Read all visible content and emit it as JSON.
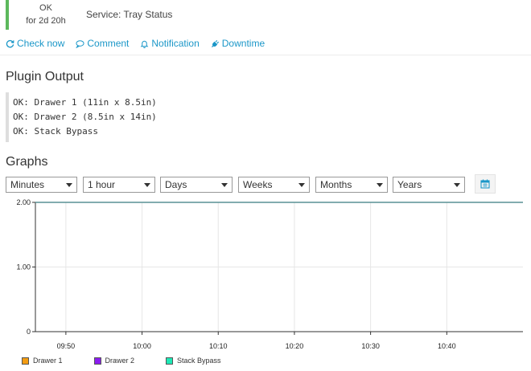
{
  "status": {
    "state": "OK",
    "duration": "for 2d 20h",
    "service": "Service: Tray Status",
    "color": "#5cb85c"
  },
  "actions": [
    {
      "label": "Check now",
      "icon": "refresh-icon"
    },
    {
      "label": "Comment",
      "icon": "comment-icon"
    },
    {
      "label": "Notification",
      "icon": "bell-icon"
    },
    {
      "label": "Downtime",
      "icon": "plug-icon"
    }
  ],
  "plugin_output": {
    "title": "Plugin Output",
    "lines": [
      "OK: Drawer 1 (11in x 8.5in)",
      "OK: Drawer 2 (8.5in x 14in)",
      "OK: Stack Bypass"
    ]
  },
  "graphs": {
    "title": "Graphs",
    "selects": [
      {
        "value": "Minutes"
      },
      {
        "value": "1 hour"
      },
      {
        "value": "Days"
      },
      {
        "value": "Weeks"
      },
      {
        "value": "Months"
      },
      {
        "value": "Years"
      }
    ],
    "calendar_icon": "calendar-icon"
  },
  "chart_data": {
    "type": "line",
    "x": [
      "09:50",
      "10:00",
      "10:10",
      "10:20",
      "10:30",
      "10:40"
    ],
    "y_ticks": [
      "2.00",
      "1.00",
      "0"
    ],
    "ylim": [
      0,
      2
    ],
    "x_start_minutes": 586,
    "x_end_minutes": 650,
    "grid": true,
    "series": [
      {
        "name": "Drawer 1",
        "color": "#f39c12",
        "values": [
          2,
          2,
          2,
          2,
          2,
          2
        ]
      },
      {
        "name": "Drawer 2",
        "color": "#8b1cf0",
        "values": [
          2,
          2,
          2,
          2,
          2,
          2
        ]
      },
      {
        "name": "Stack Bypass",
        "color": "#1de9b6",
        "values": [
          2,
          2,
          2,
          2,
          2,
          2
        ]
      }
    ],
    "line_color": "#4aa89d"
  }
}
